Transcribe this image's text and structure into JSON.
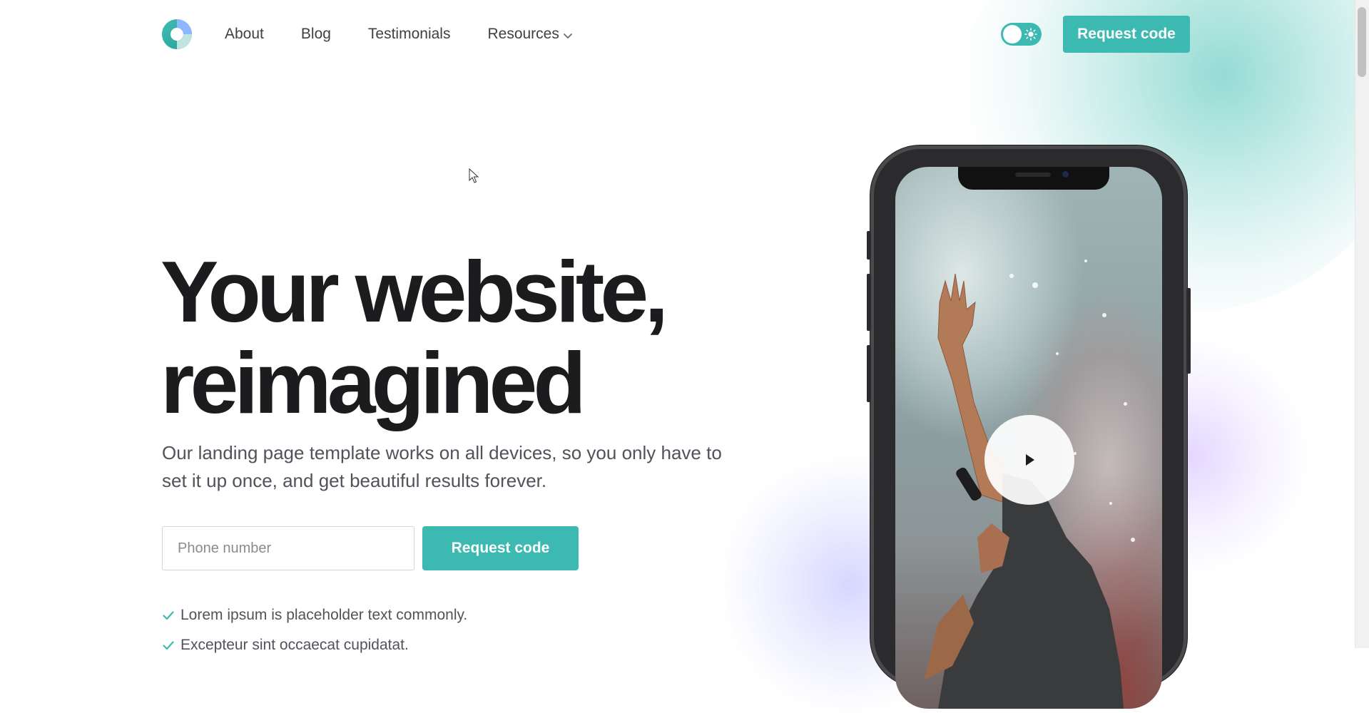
{
  "colors": {
    "accent": "#3cb9b0",
    "heading": "#1c1c1e",
    "body_text": "#52525b",
    "nav_text": "#3f3f46"
  },
  "header": {
    "logo_icon": "ring-logo-icon",
    "nav": [
      {
        "label": "About"
      },
      {
        "label": "Blog"
      },
      {
        "label": "Testimonials"
      },
      {
        "label": "Resources",
        "icon": "chevron-down-icon"
      }
    ],
    "theme_toggle_icon": "sun-icon",
    "cta_label": "Request code"
  },
  "hero": {
    "title_line1": "Your website,",
    "title_line2": "reimagined",
    "subtitle": "Our landing page template works on all devices, so you only have to set it up once, and get beautiful results forever.",
    "form": {
      "phone_placeholder": "Phone number",
      "phone_value": "",
      "submit_label": "Request code"
    },
    "checks": [
      {
        "text": "Lorem ipsum is placeholder text commonly.",
        "icon": "check-icon"
      },
      {
        "text": "Excepteur sint occaecat cupidatat.",
        "icon": "check-icon"
      }
    ]
  },
  "media": {
    "device": "smartphone-mockup",
    "play_icon": "play-icon"
  }
}
